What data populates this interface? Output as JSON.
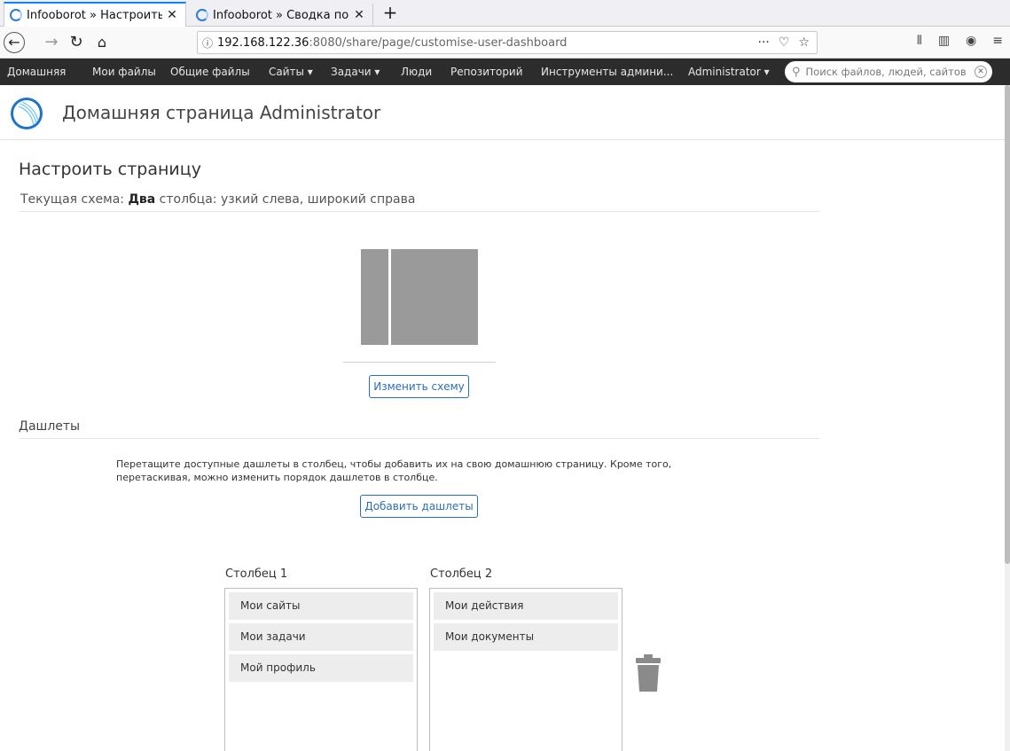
{
  "browser": {
    "tabs": [
      {
        "title": "Infooborot » Настроить с",
        "close": "✕"
      },
      {
        "title": "Infooborot » Сводка по с",
        "close": "✕"
      }
    ],
    "new_tab": "+",
    "url_info": "ⓘ",
    "url_host": "192.168.122.36",
    "url_path": ":8080/share/page/customise-user-dashboard",
    "url_actions": [
      "···",
      "♡",
      "☆"
    ]
  },
  "appbar": {
    "items": [
      "Домашняя",
      "Мои файлы",
      "Общие файлы",
      "Сайты ▾",
      "Задачи ▾",
      "Люди",
      "Репозиторий",
      "Инструменты админи...",
      "Administrator ▾"
    ],
    "search_placeholder": "Поиск файлов, людей, сайтов"
  },
  "page": {
    "title": "Домашняя страница Administrator",
    "customize_title": "Настроить страницу",
    "layout_label": "Текущая схема: ",
    "layout_bold": "Два",
    "layout_rest": " столбца: узкий слева, широкий справа",
    "change_layout_button": "Изменить схему",
    "dashlets_label": "Дашлеты",
    "instructions": "Перетащите доступные дашлеты в столбец, чтобы добавить их на свою домашнюю страницу. Кроме того, перетаскивая, можно изменить порядок дашлетов в столбце.",
    "add_dashlets_button": "Добавить дашлеты"
  },
  "columns": [
    {
      "header": "Столбец 1",
      "dashlets": [
        "Мои сайты",
        "Мои задачи",
        "Мой профиль"
      ]
    },
    {
      "header": "Столбец 2",
      "dashlets": [
        "Мои действия",
        "Мои документы"
      ]
    }
  ],
  "colors": {
    "accent": "#2a70b6",
    "appbar": "#2c2c2c",
    "layout_preview": "#9a9a9a"
  }
}
